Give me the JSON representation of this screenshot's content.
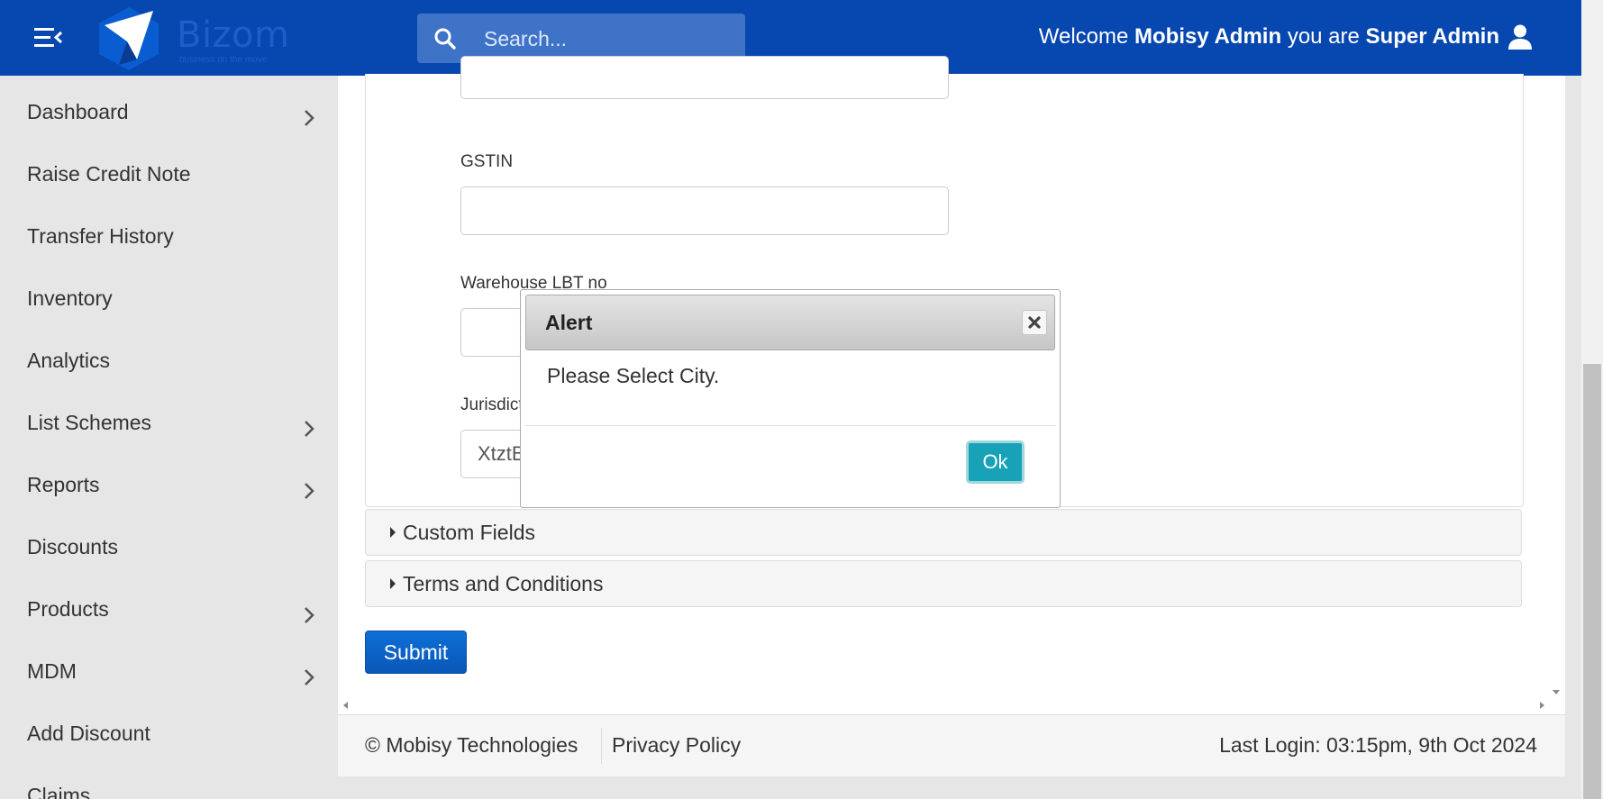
{
  "header": {
    "brand": "Bizom",
    "tagline": "business on the move",
    "search_placeholder": "Search...",
    "welcome_prefix": "Welcome",
    "user_name": "Mobisy Admin",
    "welcome_middle": "you are",
    "role": "Super Admin"
  },
  "sidebar": {
    "items": [
      {
        "label": "Dashboard",
        "has_submenu": true
      },
      {
        "label": "Raise Credit Note",
        "has_submenu": false
      },
      {
        "label": "Transfer History",
        "has_submenu": false
      },
      {
        "label": "Inventory",
        "has_submenu": false
      },
      {
        "label": "Analytics",
        "has_submenu": false
      },
      {
        "label": "List Schemes",
        "has_submenu": true
      },
      {
        "label": "Reports",
        "has_submenu": true
      },
      {
        "label": "Discounts",
        "has_submenu": false
      },
      {
        "label": "Products",
        "has_submenu": true
      },
      {
        "label": "MDM",
        "has_submenu": true
      },
      {
        "label": "Add Discount",
        "has_submenu": false
      },
      {
        "label": "Claims",
        "has_submenu": false
      }
    ]
  },
  "form": {
    "gstin_label": "GSTIN",
    "gstin_value": "",
    "lbt_label": "Warehouse LBT no",
    "lbt_value": "",
    "jurisdiction_label": "Jurisdiction",
    "jurisdiction_value": "XtztBt",
    "top_field_value": ""
  },
  "accordions": {
    "custom_fields": "Custom Fields",
    "terms": "Terms and Conditions"
  },
  "submit_label": "Submit",
  "modal": {
    "title": "Alert",
    "message": "Please Select City.",
    "ok_label": "Ok"
  },
  "footer": {
    "copyright": "© Mobisy Technologies",
    "privacy": "Privacy Policy",
    "last_login": "Last Login: 03:15pm, 9th Oct 2024"
  },
  "colors": {
    "header_bg": "#0747b0",
    "primary_button": "#0a57b9",
    "ok_button": "#17a2b8"
  }
}
